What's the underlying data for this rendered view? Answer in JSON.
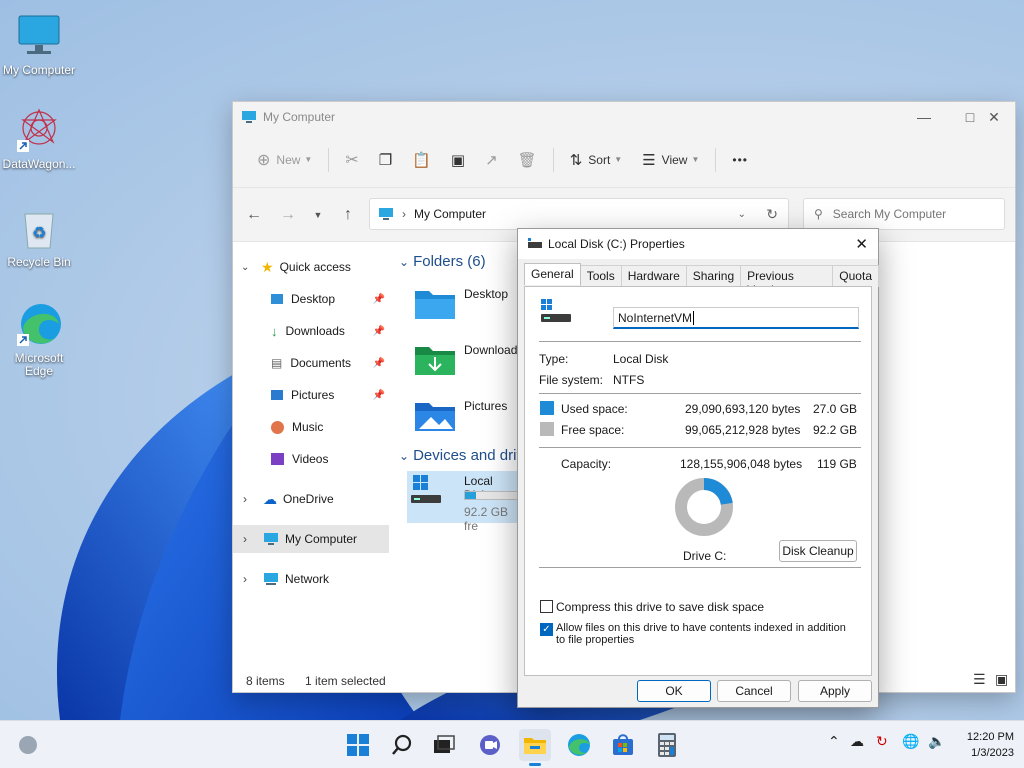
{
  "desktop": {
    "icons": [
      {
        "label": "My Computer"
      },
      {
        "label": "DataWagon..."
      },
      {
        "label": "Recycle Bin"
      },
      {
        "label": "Microsoft Edge"
      }
    ]
  },
  "explorer": {
    "title": "My Computer",
    "toolbar": {
      "new": "New",
      "sort": "Sort",
      "view": "View",
      "more": "•••"
    },
    "address": "My Computer",
    "search_placeholder": "Search My Computer",
    "nav": {
      "quick_access": "Quick access",
      "desktop": "Desktop",
      "downloads": "Downloads",
      "documents": "Documents",
      "pictures": "Pictures",
      "music": "Music",
      "videos": "Videos",
      "onedrive": "OneDrive",
      "my_computer": "My Computer",
      "network": "Network"
    },
    "folders_header": "Folders (6)",
    "folders": [
      {
        "label": "Desktop"
      },
      {
        "label": "Download"
      },
      {
        "label": "Pictures"
      }
    ],
    "devices_header": "Devices and driv",
    "drive": {
      "name": "Local Disk",
      "free": "92.2 GB fre",
      "used_fraction": 0.21
    },
    "status": {
      "items": "8 items",
      "selected": "1 item selected"
    }
  },
  "dialog": {
    "title": "Local Disk (C:) Properties",
    "tabs": [
      "General",
      "Tools",
      "Hardware",
      "Sharing",
      "Previous Versions",
      "Quota"
    ],
    "volume_name": "NoInternetVM",
    "type_label": "Type:",
    "type_value": "Local Disk",
    "fs_label": "File system:",
    "fs_value": "NTFS",
    "used_label": "Used space:",
    "used_bytes": "29,090,693,120 bytes",
    "used_gb": "27.0 GB",
    "free_label": "Free space:",
    "free_bytes": "99,065,212,928 bytes",
    "free_gb": "92.2 GB",
    "capacity_label": "Capacity:",
    "capacity_bytes": "128,155,906,048 bytes",
    "capacity_gb": "119 GB",
    "used_fraction": 0.227,
    "drive_label": "Drive C:",
    "cleanup": "Disk Cleanup",
    "compress": "Compress this drive to save disk space",
    "index": "Allow files on this drive to have contents indexed in addition to file properties",
    "ok": "OK",
    "cancel": "Cancel",
    "apply": "Apply",
    "colors": {
      "used": "#1f8ad6",
      "free": "#b9b9b9"
    }
  },
  "taskbar": {
    "time": "12:20 PM",
    "date": "1/3/2023"
  }
}
